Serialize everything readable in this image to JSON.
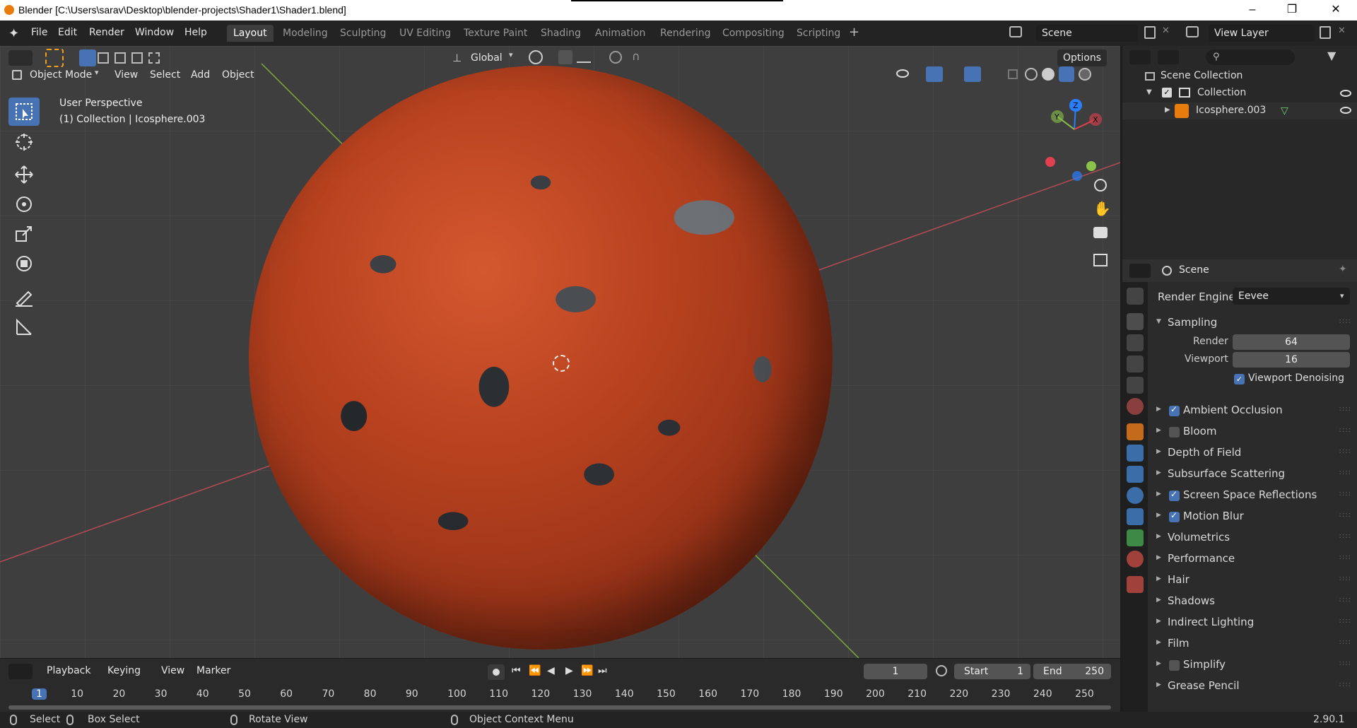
{
  "window": {
    "title": "Blender [C:\\Users\\sarav\\Desktop\\blender-projects\\Shader1\\Shader1.blend]"
  },
  "menu": [
    "File",
    "Edit",
    "Render",
    "Window",
    "Help"
  ],
  "workspaces": [
    {
      "label": "Layout",
      "active": true
    },
    {
      "label": "Modeling"
    },
    {
      "label": "Sculpting"
    },
    {
      "label": "UV Editing"
    },
    {
      "label": "Texture Paint"
    },
    {
      "label": "Shading"
    },
    {
      "label": "Animation"
    },
    {
      "label": "Rendering"
    },
    {
      "label": "Compositing"
    },
    {
      "label": "Scripting"
    }
  ],
  "scene_field": "Scene",
  "view_layer_field": "View Layer",
  "viewport": {
    "transform_orientation": "Global",
    "options_label": "Options",
    "mode": "Object Mode",
    "menu": [
      "View",
      "Select",
      "Add",
      "Object"
    ],
    "overlay_line1": "User Perspective",
    "overlay_line2": "(1) Collection | Icosphere.003",
    "gizmo_axes": [
      "X",
      "Y",
      "Z"
    ]
  },
  "outliner": {
    "scene_collection": "Scene Collection",
    "collection": "Collection",
    "object": "Icosphere.003"
  },
  "properties": {
    "header": "Scene",
    "render_engine_label": "Render Engine",
    "render_engine_value": "Eevee",
    "sampling": {
      "title": "Sampling",
      "render_label": "Render",
      "render_value": "64",
      "viewport_label": "Viewport",
      "viewport_value": "16",
      "denoise_label": "Viewport Denoising"
    },
    "panels": [
      {
        "label": "Ambient Occlusion",
        "checkbox": true,
        "checked": true
      },
      {
        "label": "Bloom",
        "checkbox": true,
        "checked": false
      },
      {
        "label": "Depth of Field"
      },
      {
        "label": "Subsurface Scattering"
      },
      {
        "label": "Screen Space Reflections",
        "checkbox": true,
        "checked": true
      },
      {
        "label": "Motion Blur",
        "checkbox": true,
        "checked": true
      },
      {
        "label": "Volumetrics"
      },
      {
        "label": "Performance"
      },
      {
        "label": "Hair"
      },
      {
        "label": "Shadows"
      },
      {
        "label": "Indirect Lighting"
      },
      {
        "label": "Film"
      },
      {
        "label": "Simplify",
        "checkbox": true,
        "checked": false
      },
      {
        "label": "Grease Pencil"
      }
    ]
  },
  "timeline": {
    "menu": [
      "Playback",
      "Keying",
      "View",
      "Marker"
    ],
    "current_frame": "1",
    "start_label": "Start",
    "start_value": "1",
    "end_label": "End",
    "end_value": "250",
    "ticks": [
      "1",
      "10",
      "20",
      "30",
      "40",
      "50",
      "60",
      "70",
      "80",
      "90",
      "100",
      "110",
      "120",
      "130",
      "140",
      "150",
      "160",
      "170",
      "180",
      "190",
      "200",
      "210",
      "220",
      "230",
      "240",
      "250"
    ]
  },
  "statusbar": {
    "select": "Select",
    "box_select": "Box Select",
    "rotate_view": "Rotate View",
    "context_menu": "Object Context Menu",
    "version": "2.90.1"
  },
  "colors": {
    "accent": "#4772b3",
    "x_axis": "#e0404f",
    "y_axis": "#8bc34a",
    "z_axis": "#2a7fff"
  }
}
